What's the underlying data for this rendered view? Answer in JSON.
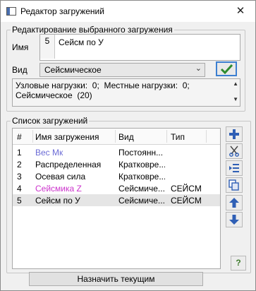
{
  "window": {
    "title": "Редактор загружений",
    "close_glyph": "✕"
  },
  "edit_group": {
    "legend": "Редактирование выбранного загружения",
    "name_label": "Имя",
    "current_number": "5",
    "current_name": "Сейсм по У",
    "type_label": "Вид",
    "type_value": "Сейсмическое",
    "info_line1": "Узловые нагрузки:  0;  Местные нагрузки:  0;",
    "info_line2": "Сейсмическое  (20)"
  },
  "list_group": {
    "legend": "Список загружений",
    "columns": [
      "#",
      "Имя загружения",
      "Вид",
      "Тип"
    ],
    "rows": [
      {
        "num": "1",
        "name": "Вес Мк",
        "kind": "Постоянн...",
        "type": "",
        "color": "#6b6bd6"
      },
      {
        "num": "2",
        "name": "Распределенная",
        "kind": "Кратковре...",
        "type": "",
        "color": "#000000"
      },
      {
        "num": "3",
        "name": "Осевая сила",
        "kind": "Кратковре...",
        "type": "",
        "color": "#000000"
      },
      {
        "num": "4",
        "name": "Сейсмика Z",
        "kind": "Сейсмиче...",
        "type": "СЕЙСМ",
        "color": "#cc33cc"
      },
      {
        "num": "5",
        "name": "Сейсм по У",
        "kind": "Сейсмиче...",
        "type": "СЕЙСМ",
        "color": "#000000"
      }
    ]
  },
  "buttons": {
    "assign_label": "Назначить текущим",
    "help_label": "?"
  },
  "colors": {
    "accent_blue": "#2f5fb5",
    "check_green": "#2e8b2e",
    "selected_row": "#e5e5e5"
  }
}
